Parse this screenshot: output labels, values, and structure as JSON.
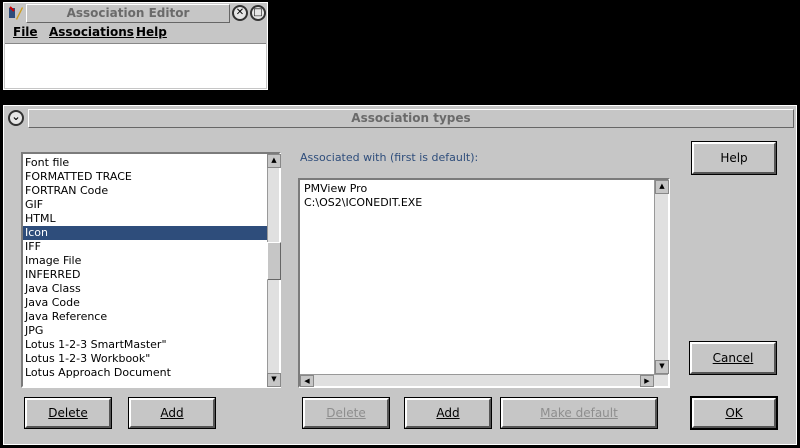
{
  "editor": {
    "title": "Association Editor",
    "menu": {
      "file": "File",
      "associations": "Associations",
      "help": "Help"
    }
  },
  "types": {
    "title": "Association types",
    "list_items": [
      "Font file",
      "FORMATTED TRACE",
      "FORTRAN Code",
      "GIF",
      "HTML",
      "Icon",
      "IFF",
      "Image File",
      "INFERRED",
      "Java Class",
      "Java Code",
      "Java Reference",
      "JPG",
      "Lotus 1-2-3 SmartMaster\"",
      "Lotus 1-2-3 Workbook\"",
      "Lotus Approach Document"
    ],
    "selected_index": 5,
    "assoc_label": "Associated with (first is default):",
    "assoc_items": [
      "PMView Pro",
      "C:\\OS2\\ICONEDIT.EXE"
    ],
    "buttons": {
      "help": "Help",
      "cancel": "Cancel",
      "ok": "OK",
      "type_delete": "Delete",
      "type_add": "Add",
      "assoc_delete": "Delete",
      "assoc_add": "Add",
      "make_default": "Make default"
    }
  },
  "colors": {
    "selection": "#2e4d7b",
    "label": "#2e4d7b"
  }
}
